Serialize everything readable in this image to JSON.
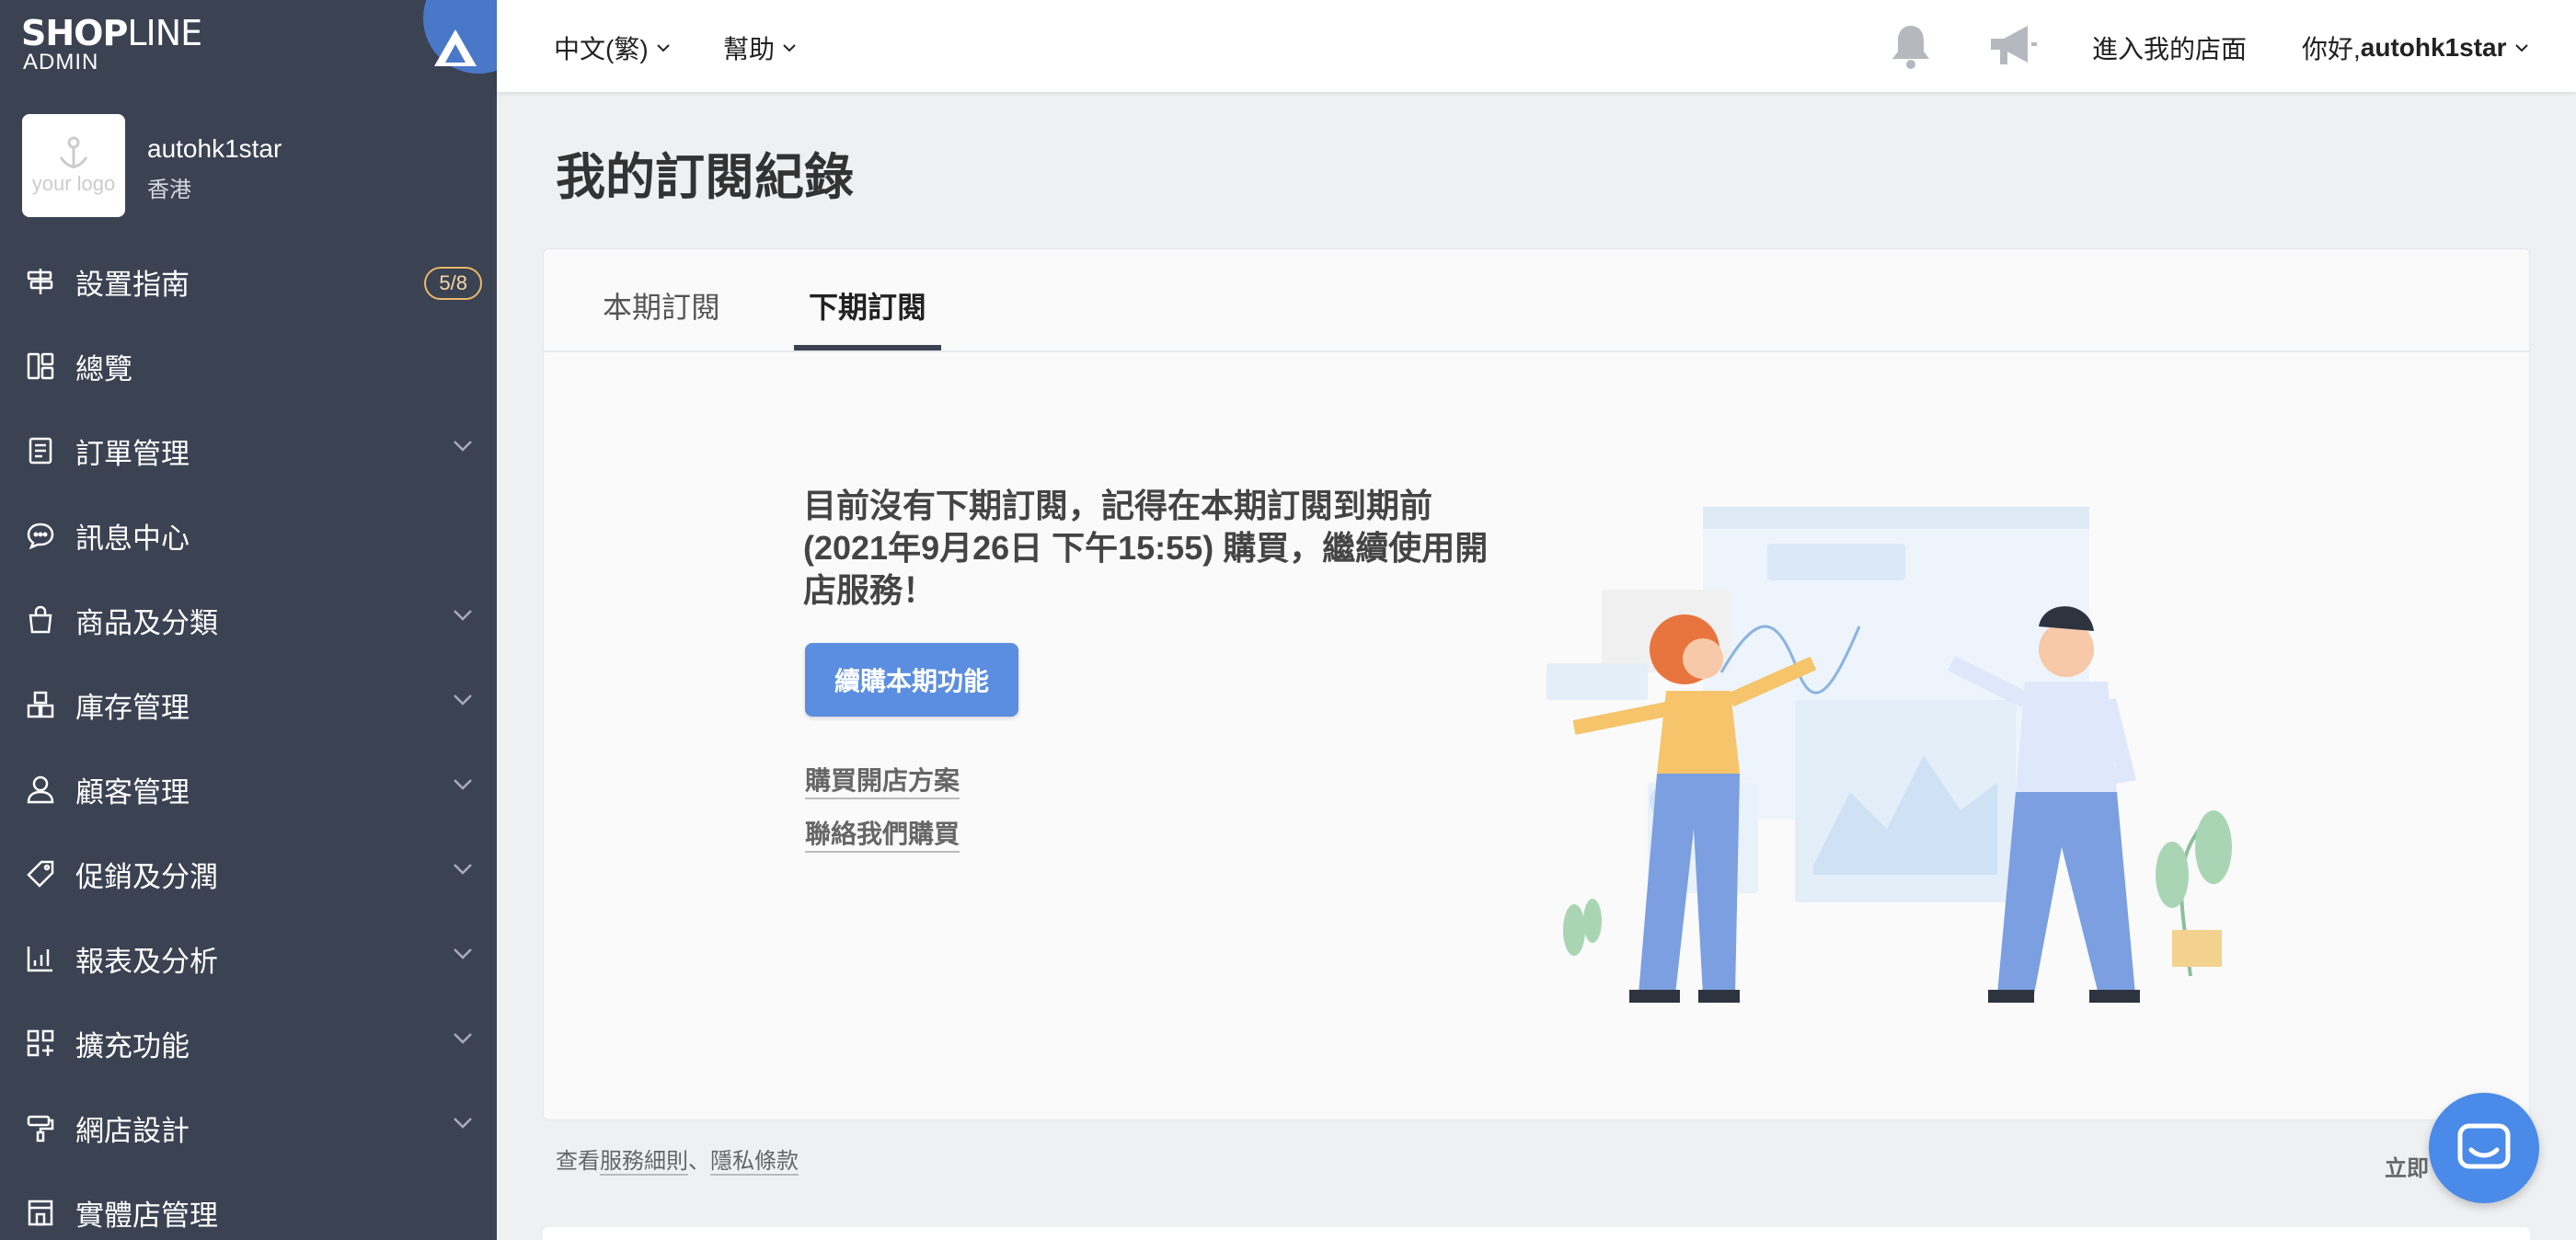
{
  "brand": {
    "logo_main": "SHOP",
    "logo_rest": "LINE",
    "logo_sub": "ADMIN"
  },
  "store": {
    "logo_placeholder": "your logo",
    "name": "autohk1star",
    "region": "香港"
  },
  "sidebar": {
    "items": [
      {
        "label": "設置指南",
        "badge": "5/8",
        "icon": "signpost-icon"
      },
      {
        "label": "總覽",
        "icon": "dashboard-icon"
      },
      {
        "label": "訂單管理",
        "icon": "receipt-icon",
        "expandable": true
      },
      {
        "label": "訊息中心",
        "icon": "chat-icon"
      },
      {
        "label": "商品及分類",
        "icon": "bag-icon",
        "expandable": true
      },
      {
        "label": "庫存管理",
        "icon": "boxes-icon",
        "expandable": true
      },
      {
        "label": "顧客管理",
        "icon": "user-icon",
        "expandable": true
      },
      {
        "label": "促銷及分潤",
        "icon": "tag-icon",
        "expandable": true
      },
      {
        "label": "報表及分析",
        "icon": "chart-icon",
        "expandable": true
      },
      {
        "label": "擴充功能",
        "icon": "apps-icon",
        "expandable": true
      },
      {
        "label": "網店設計",
        "icon": "paint-roller-icon",
        "expandable": true
      },
      {
        "label": "實體店管理",
        "icon": "store-icon"
      }
    ]
  },
  "topbar": {
    "language": "中文(繁)",
    "help": "幫助",
    "enter_store": "進入我的店面",
    "greeting": "你好, ",
    "username": "autohk1star"
  },
  "page": {
    "title": "我的訂閱紀錄",
    "tabs": [
      {
        "label": "本期訂閱",
        "active": false
      },
      {
        "label": "下期訂閱",
        "active": true
      }
    ],
    "message": "目前沒有下期訂閱，記得在本期訂閱到期前 (2021年9月26日 下午15:55) 購買，繼續使用開店服務！",
    "renew_button": "續購本期功能",
    "link_buy_plan": "購買開店方案",
    "link_contact": "聯絡我們購買"
  },
  "footer": {
    "prefix": "查看",
    "terms": "服務細則",
    "separator": "、",
    "privacy": "隱私條款",
    "right_text": "立即"
  },
  "colors": {
    "sidebar_bg": "#3b4252",
    "primary_button": "#5b8ee0",
    "badge_border": "#e8b86a",
    "chat_button": "#4a8ae8"
  }
}
